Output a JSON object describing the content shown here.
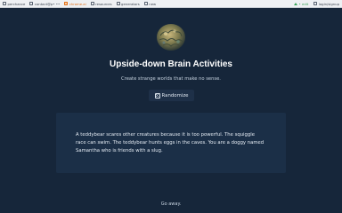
{
  "topbar": {
    "bookmarks": [
      {
        "label": "perchance",
        "active": false
      },
      {
        "label": "contact@p• ••",
        "active": false
      },
      {
        "label": "chrome.ai",
        "active": true
      },
      {
        "label": "resources",
        "active": false
      },
      {
        "label": "generators",
        "active": false
      },
      {
        "label": "new",
        "active": false
      }
    ],
    "credit": "• edit",
    "login": "login/signup"
  },
  "main": {
    "title": "Upside-down Brain Activities",
    "subtitle": "Create strange worlds that make no sense.",
    "randomize_label": "Randomize",
    "output": "A teddybear scares other creatures because it is too powerful. The squiggle race can swim. The teddybear hunts eggs in the caves. You are a doggy named Samantha who is friends with a slug."
  },
  "footer": {
    "text": "Go away."
  }
}
